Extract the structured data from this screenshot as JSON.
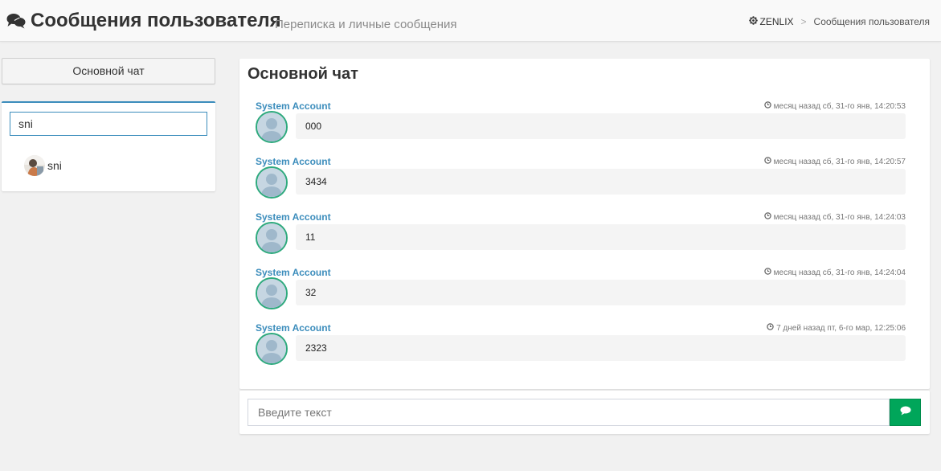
{
  "header": {
    "title": "Сообщения пользователя",
    "subtitle": "Переписка и личные сообщения",
    "icon": "comments-icon"
  },
  "breadcrumb": {
    "home_label": "ZENLIX",
    "home_icon": "gear-icon",
    "separator": ">",
    "current": "Сообщения пользователя"
  },
  "sidebar": {
    "main_chat_label": "Основной чат",
    "search_value": "sni",
    "users": [
      {
        "name": "sni"
      }
    ]
  },
  "chat": {
    "title": "Основной чат",
    "messages": [
      {
        "author": "System Account",
        "time": "месяц назад сб, 31-го янв, 14:20:53",
        "text": "000"
      },
      {
        "author": "System Account",
        "time": "месяц назад сб, 31-го янв, 14:20:57",
        "text": "3434"
      },
      {
        "author": "System Account",
        "time": "месяц назад сб, 31-го янв, 14:24:03",
        "text": "11"
      },
      {
        "author": "System Account",
        "time": "месяц назад сб, 31-го янв, 14:24:04",
        "text": "32"
      },
      {
        "author": "System Account",
        "time": "7 дней назад пт, 6-го мар, 12:25:06",
        "text": "2323"
      }
    ]
  },
  "composer": {
    "placeholder": "Введите текст",
    "send_icon": "comment-icon"
  },
  "colors": {
    "accent": "#3c8dbc",
    "send_button": "#00a65a",
    "avatar_border": "#2eaa7d"
  }
}
